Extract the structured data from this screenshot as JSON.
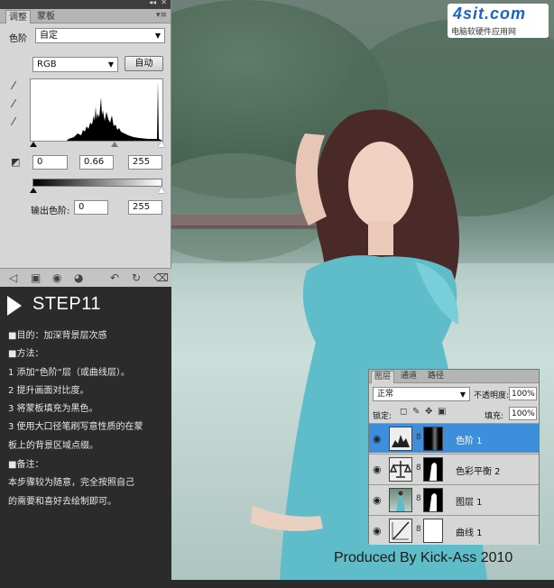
{
  "adjustments_panel": {
    "tabs": [
      "调整",
      "蒙板"
    ],
    "preset_label": "色阶",
    "preset_value": "自定",
    "channel_value": "RGB",
    "auto_button": "自动",
    "input_black": "0",
    "input_gamma": "0.66",
    "input_white": "255",
    "output_label": "输出色阶:",
    "output_black": "0",
    "output_white": "255"
  },
  "tutorial": {
    "step_title": "STEP11",
    "lines": [
      "■目的：加深背景层次感",
      "■方法：",
      "1 添加“色阶”层（或曲线层）。",
      "2 提升画面对比度。",
      "3 将蒙板填充为黑色。",
      "3 使用大口径笔刷写意性质的在蒙",
      "   板上的背景区域点缀。",
      "■备注：",
      "   本步骤较为随意，完全按照自己",
      "   的需要和喜好去绘制即可。"
    ]
  },
  "photo": {
    "watermark_logo": "4sit.com",
    "watermark_sub": "电脑软硬件应用网",
    "credit": "Produced By Kick-Ass 2010"
  },
  "layers_panel": {
    "tabs": [
      "图层",
      "通道",
      "路径"
    ],
    "blend_mode": "正常",
    "opacity_label": "不透明度:",
    "opacity_value": "100%",
    "lock_label": "锁定:",
    "fill_label": "填充:",
    "fill_value": "100%",
    "layers": [
      {
        "name": "色阶 1",
        "selected": true
      },
      {
        "name": "色彩平衡 2",
        "selected": false
      },
      {
        "name": "图层 1",
        "selected": false
      },
      {
        "name": "曲线 1",
        "selected": false
      }
    ]
  },
  "colors": {
    "selected_layer": "#3d8edb",
    "panel_bg": "#d6d6d6",
    "tutorial_bg": "#2b2b2b"
  },
  "icons": [
    "eyedropper-black-icon",
    "eyedropper-gray-icon",
    "eyedropper-white-icon",
    "eye-icon",
    "chain-icon",
    "trash-icon",
    "reset-icon",
    "panel-menu-icon"
  ]
}
